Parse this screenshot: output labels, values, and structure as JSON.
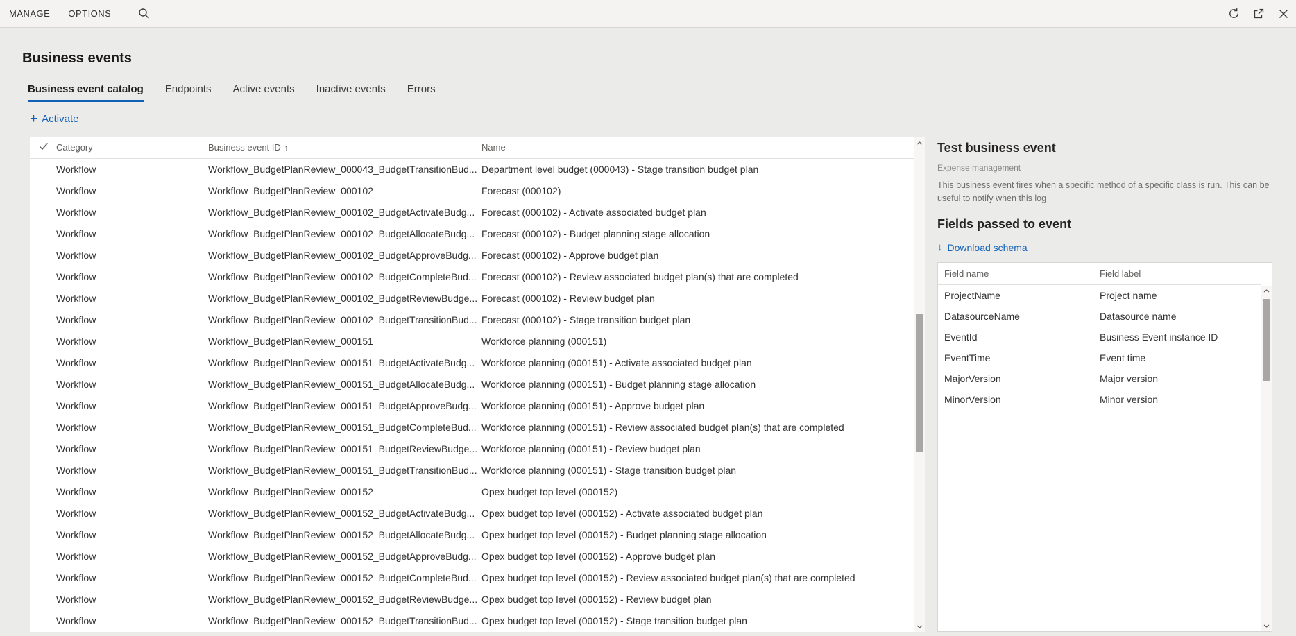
{
  "colors": {
    "accent": "#1160b7",
    "background": "#ebebea",
    "panel": "#ffffff"
  },
  "glyphs": {
    "plus": "+",
    "sort_ascending": "↑",
    "download_arrow": "↓"
  },
  "top_bar": {
    "menu_items": [
      {
        "label": "MANAGE"
      },
      {
        "label": "OPTIONS"
      }
    ]
  },
  "page": {
    "title": "Business events",
    "tabs": [
      {
        "label": "Business event catalog",
        "active": true
      },
      {
        "label": "Endpoints",
        "active": false
      },
      {
        "label": "Active events",
        "active": false
      },
      {
        "label": "Inactive events",
        "active": false
      },
      {
        "label": "Errors",
        "active": false
      }
    ],
    "toolbar": {
      "activate_label": "Activate"
    }
  },
  "catalog": {
    "columns": {
      "category": "Category",
      "event_id": "Business event ID",
      "name": "Name"
    },
    "rows": [
      {
        "category": "Workflow",
        "event_id": "Workflow_BudgetPlanReview_000043_BudgetTransitionBud...",
        "name": "Department level budget (000043) - Stage transition budget plan"
      },
      {
        "category": "Workflow",
        "event_id": "Workflow_BudgetPlanReview_000102",
        "name": "Forecast (000102)"
      },
      {
        "category": "Workflow",
        "event_id": "Workflow_BudgetPlanReview_000102_BudgetActivateBudg...",
        "name": "Forecast (000102) - Activate associated budget plan"
      },
      {
        "category": "Workflow",
        "event_id": "Workflow_BudgetPlanReview_000102_BudgetAllocateBudg...",
        "name": "Forecast (000102) - Budget planning stage allocation"
      },
      {
        "category": "Workflow",
        "event_id": "Workflow_BudgetPlanReview_000102_BudgetApproveBudg...",
        "name": "Forecast (000102) - Approve budget plan"
      },
      {
        "category": "Workflow",
        "event_id": "Workflow_BudgetPlanReview_000102_BudgetCompleteBud...",
        "name": "Forecast (000102) - Review associated budget plan(s) that are completed"
      },
      {
        "category": "Workflow",
        "event_id": "Workflow_BudgetPlanReview_000102_BudgetReviewBudge...",
        "name": "Forecast (000102) - Review budget plan"
      },
      {
        "category": "Workflow",
        "event_id": "Workflow_BudgetPlanReview_000102_BudgetTransitionBud...",
        "name": "Forecast (000102) - Stage transition budget plan"
      },
      {
        "category": "Workflow",
        "event_id": "Workflow_BudgetPlanReview_000151",
        "name": "Workforce planning (000151)"
      },
      {
        "category": "Workflow",
        "event_id": "Workflow_BudgetPlanReview_000151_BudgetActivateBudg...",
        "name": "Workforce planning (000151) - Activate associated budget plan"
      },
      {
        "category": "Workflow",
        "event_id": "Workflow_BudgetPlanReview_000151_BudgetAllocateBudg...",
        "name": "Workforce planning (000151) - Budget planning stage allocation"
      },
      {
        "category": "Workflow",
        "event_id": "Workflow_BudgetPlanReview_000151_BudgetApproveBudg...",
        "name": "Workforce planning (000151) - Approve budget plan"
      },
      {
        "category": "Workflow",
        "event_id": "Workflow_BudgetPlanReview_000151_BudgetCompleteBud...",
        "name": "Workforce planning (000151) - Review associated budget plan(s) that are completed"
      },
      {
        "category": "Workflow",
        "event_id": "Workflow_BudgetPlanReview_000151_BudgetReviewBudge...",
        "name": "Workforce planning (000151) - Review budget plan"
      },
      {
        "category": "Workflow",
        "event_id": "Workflow_BudgetPlanReview_000151_BudgetTransitionBud...",
        "name": "Workforce planning (000151) - Stage transition budget plan"
      },
      {
        "category": "Workflow",
        "event_id": "Workflow_BudgetPlanReview_000152",
        "name": "Opex budget top level (000152)"
      },
      {
        "category": "Workflow",
        "event_id": "Workflow_BudgetPlanReview_000152_BudgetActivateBudg...",
        "name": "Opex budget top level (000152) - Activate associated budget plan"
      },
      {
        "category": "Workflow",
        "event_id": "Workflow_BudgetPlanReview_000152_BudgetAllocateBudg...",
        "name": "Opex budget top level (000152) - Budget planning stage allocation"
      },
      {
        "category": "Workflow",
        "event_id": "Workflow_BudgetPlanReview_000152_BudgetApproveBudg...",
        "name": "Opex budget top level (000152) - Approve budget plan"
      },
      {
        "category": "Workflow",
        "event_id": "Workflow_BudgetPlanReview_000152_BudgetCompleteBud...",
        "name": "Opex budget top level (000152) - Review associated budget plan(s) that are completed"
      },
      {
        "category": "Workflow",
        "event_id": "Workflow_BudgetPlanReview_000152_BudgetReviewBudge...",
        "name": "Opex budget top level (000152) - Review budget plan"
      },
      {
        "category": "Workflow",
        "event_id": "Workflow_BudgetPlanReview_000152_BudgetTransitionBud...",
        "name": "Opex budget top level (000152) - Stage transition budget plan"
      }
    ]
  },
  "details": {
    "title": "Test business event",
    "subtitle": "Expense management",
    "description": "This business event fires when a specific method of a specific class is run. This can be useful to notify when this log",
    "fields_title": "Fields passed to event",
    "download_label": "Download schema",
    "fields_columns": {
      "name": "Field name",
      "label": "Field label"
    },
    "fields": [
      {
        "name": "ProjectName",
        "label": "Project name"
      },
      {
        "name": "DatasourceName",
        "label": "Datasource name"
      },
      {
        "name": "EventId",
        "label": "Business Event instance ID"
      },
      {
        "name": "EventTime",
        "label": "Event time"
      },
      {
        "name": "MajorVersion",
        "label": "Major version"
      },
      {
        "name": "MinorVersion",
        "label": "Minor version"
      }
    ]
  }
}
